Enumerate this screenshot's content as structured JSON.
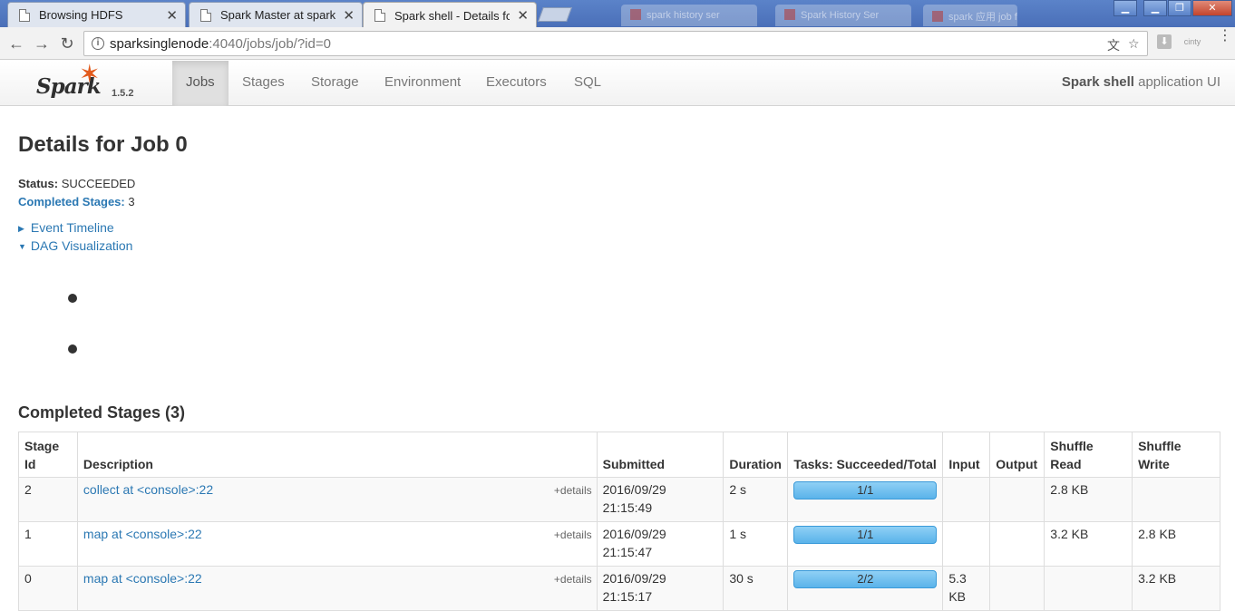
{
  "browser": {
    "tabs": [
      {
        "title": "Browsing HDFS",
        "active": false
      },
      {
        "title": "Spark Master at sparksi",
        "active": false
      },
      {
        "title": "Spark shell - Details for",
        "active": true
      }
    ],
    "background_tabs": [
      {
        "title": "spark history ser"
      },
      {
        "title": "Spark History Ser"
      },
      {
        "title": "spark 应用 job fc"
      }
    ],
    "url_host": "sparksinglenode",
    "url_path": ":4040/jobs/job/?id=0",
    "window_controls": {
      "min": "▁",
      "restore": "❐",
      "close": "✕"
    },
    "icons": {
      "back": "arrow-left-icon",
      "forward": "arrow-right-icon",
      "reload": "reload-icon",
      "info": "info-icon",
      "translate": "translate-icon",
      "star": "star-icon",
      "menu": "menu-icon"
    },
    "ext_label": "cinty"
  },
  "navbar": {
    "brand_word": "Spark",
    "version": "1.5.2",
    "items": [
      {
        "label": "Jobs",
        "active": true
      },
      {
        "label": "Stages",
        "active": false
      },
      {
        "label": "Storage",
        "active": false
      },
      {
        "label": "Environment",
        "active": false
      },
      {
        "label": "Executors",
        "active": false
      },
      {
        "label": "SQL",
        "active": false
      }
    ],
    "app_name": "Spark shell",
    "app_suffix": " application UI"
  },
  "page": {
    "title": "Details for Job 0",
    "status_label": "Status:",
    "status_value": "SUCCEEDED",
    "completed_label": "Completed Stages:",
    "completed_value": "3",
    "event_timeline": "Event Timeline",
    "dag_visualization": "DAG Visualization",
    "section_title": "Completed Stages (3)"
  },
  "table": {
    "headers": [
      "Stage Id",
      "Description",
      "Submitted",
      "Duration",
      "Tasks: Succeeded/Total",
      "Input",
      "Output",
      "Shuffle Read",
      "Shuffle Write"
    ],
    "rows": [
      {
        "id": "2",
        "description": "collect at <console>:22",
        "details": "+details",
        "submitted": "2016/09/29 21:15:49",
        "duration": "2 s",
        "tasks": "1/1",
        "tasks_fraction": 1.0,
        "input": "",
        "output": "",
        "shuffle_read": "2.8 KB",
        "shuffle_write": ""
      },
      {
        "id": "1",
        "description": "map at <console>:22",
        "details": "+details",
        "submitted": "2016/09/29 21:15:47",
        "duration": "1 s",
        "tasks": "1/1",
        "tasks_fraction": 1.0,
        "input": "",
        "output": "",
        "shuffle_read": "3.2 KB",
        "shuffle_write": "2.8 KB"
      },
      {
        "id": "0",
        "description": "map at <console>:22",
        "details": "+details",
        "submitted": "2016/09/29 21:15:17",
        "duration": "30 s",
        "tasks": "2/2",
        "tasks_fraction": 1.0,
        "input": "5.3 KB",
        "output": "",
        "shuffle_read": "",
        "shuffle_write": "3.2 KB"
      }
    ]
  }
}
